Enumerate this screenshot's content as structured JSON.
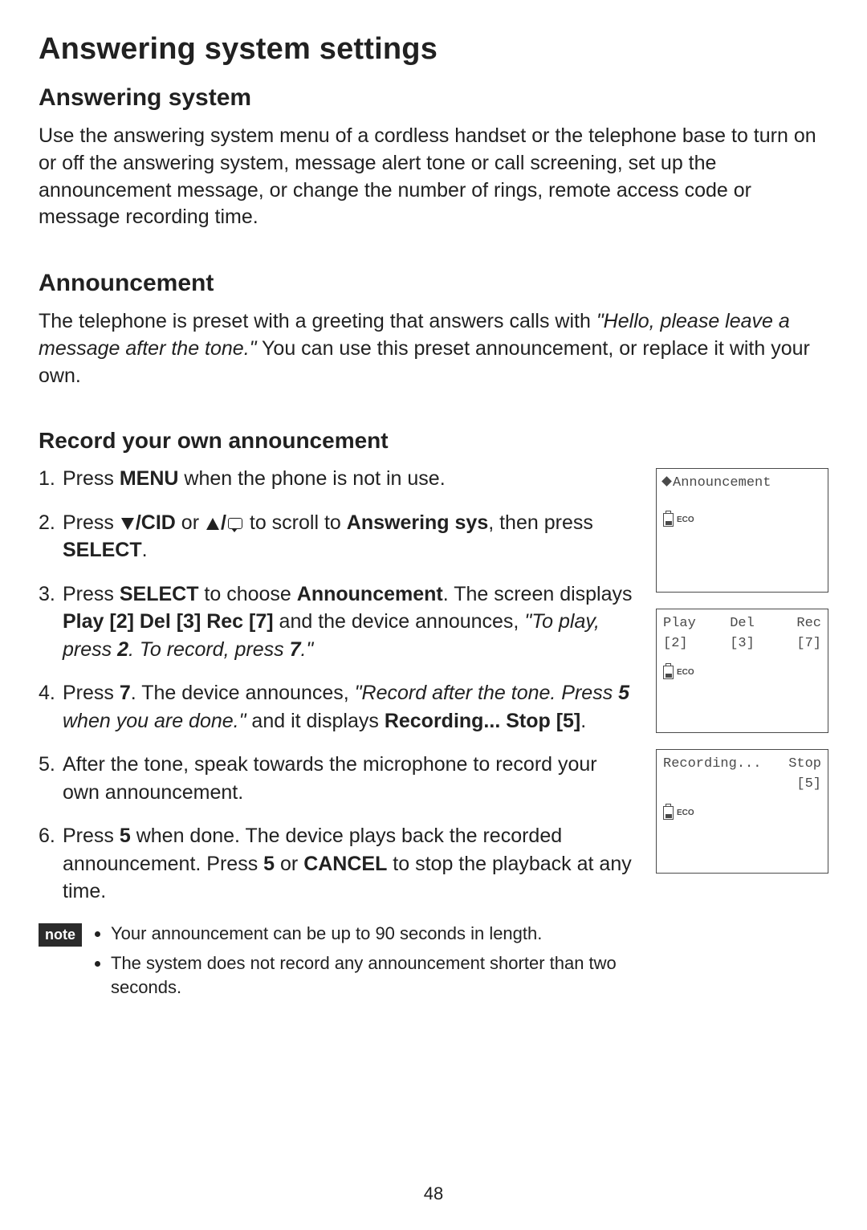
{
  "page_number": "48",
  "title": "Answering system settings",
  "section1": {
    "heading": "Answering system",
    "body": "Use the answering system menu of a cordless handset or the telephone base to turn on or off the answering system, message alert tone or call screening, set up the announcement message, or change the number of rings, remote access code or message recording time."
  },
  "section2": {
    "heading": "Announcement",
    "body_pre": "The telephone is preset with a greeting that answers calls with ",
    "body_quote": "\"Hello, please leave a message after the tone.\"",
    "body_post": "  You can use this preset announcement, or replace it with your own."
  },
  "section3": {
    "heading": "Record your own announcement",
    "steps": {
      "1": {
        "pre": "Press ",
        "b1": "MENU",
        "post": " when the phone is not in use."
      },
      "2": {
        "pre": "Press ",
        "b1": "/CID",
        "mid": " or ",
        "b2": "/",
        "mid2": " to scroll to ",
        "b3": "Answering sys",
        "post": ", then press ",
        "b4": "SELECT",
        "end": "."
      },
      "3": {
        "pre": "Press ",
        "b1": "SELECT",
        "mid": " to choose ",
        "b2": "Announcement",
        "mid2": ". The screen displays ",
        "b3": "Play [2] Del [3] Rec [7]",
        "post": " and the device announces, ",
        "quote_a": "\"To play, press ",
        "quote_b": "2",
        "quote_c": ". To record, press ",
        "quote_d": "7",
        "quote_e": ".\""
      },
      "4": {
        "pre": "Press ",
        "b1": "7",
        "mid": ". The device announces, ",
        "quote_a": "\"Record after the tone. Press ",
        "quote_b": "5",
        "quote_c": " when you are done.\"",
        "post": "  and it displays ",
        "b2": "Recording... Stop [5]",
        "end": "."
      },
      "5": {
        "text": "After the tone, speak towards the microphone to record your own announcement."
      },
      "6": {
        "pre": "Press ",
        "b1": "5",
        "mid": " when done. The device plays back the recorded announcement. Press ",
        "b2": "5",
        "mid2": " or ",
        "b3": "CANCEL",
        "post": " to stop the playback at any time."
      }
    }
  },
  "note_badge": "note",
  "notes": {
    "1": "Your announcement can be up to 90 seconds in length.",
    "2": "The system does not record any announcement shorter than two seconds."
  },
  "lcd": {
    "eco": "ECO",
    "screen1": {
      "line1": "Announcement"
    },
    "screen2": {
      "c1": "Play",
      "c2": "Del",
      "c3": "Rec",
      "k1": "[2]",
      "k2": "[3]",
      "k3": "[7]"
    },
    "screen3": {
      "l1a": "Recording...",
      "l1b": "Stop",
      "l2": "[5]"
    }
  }
}
